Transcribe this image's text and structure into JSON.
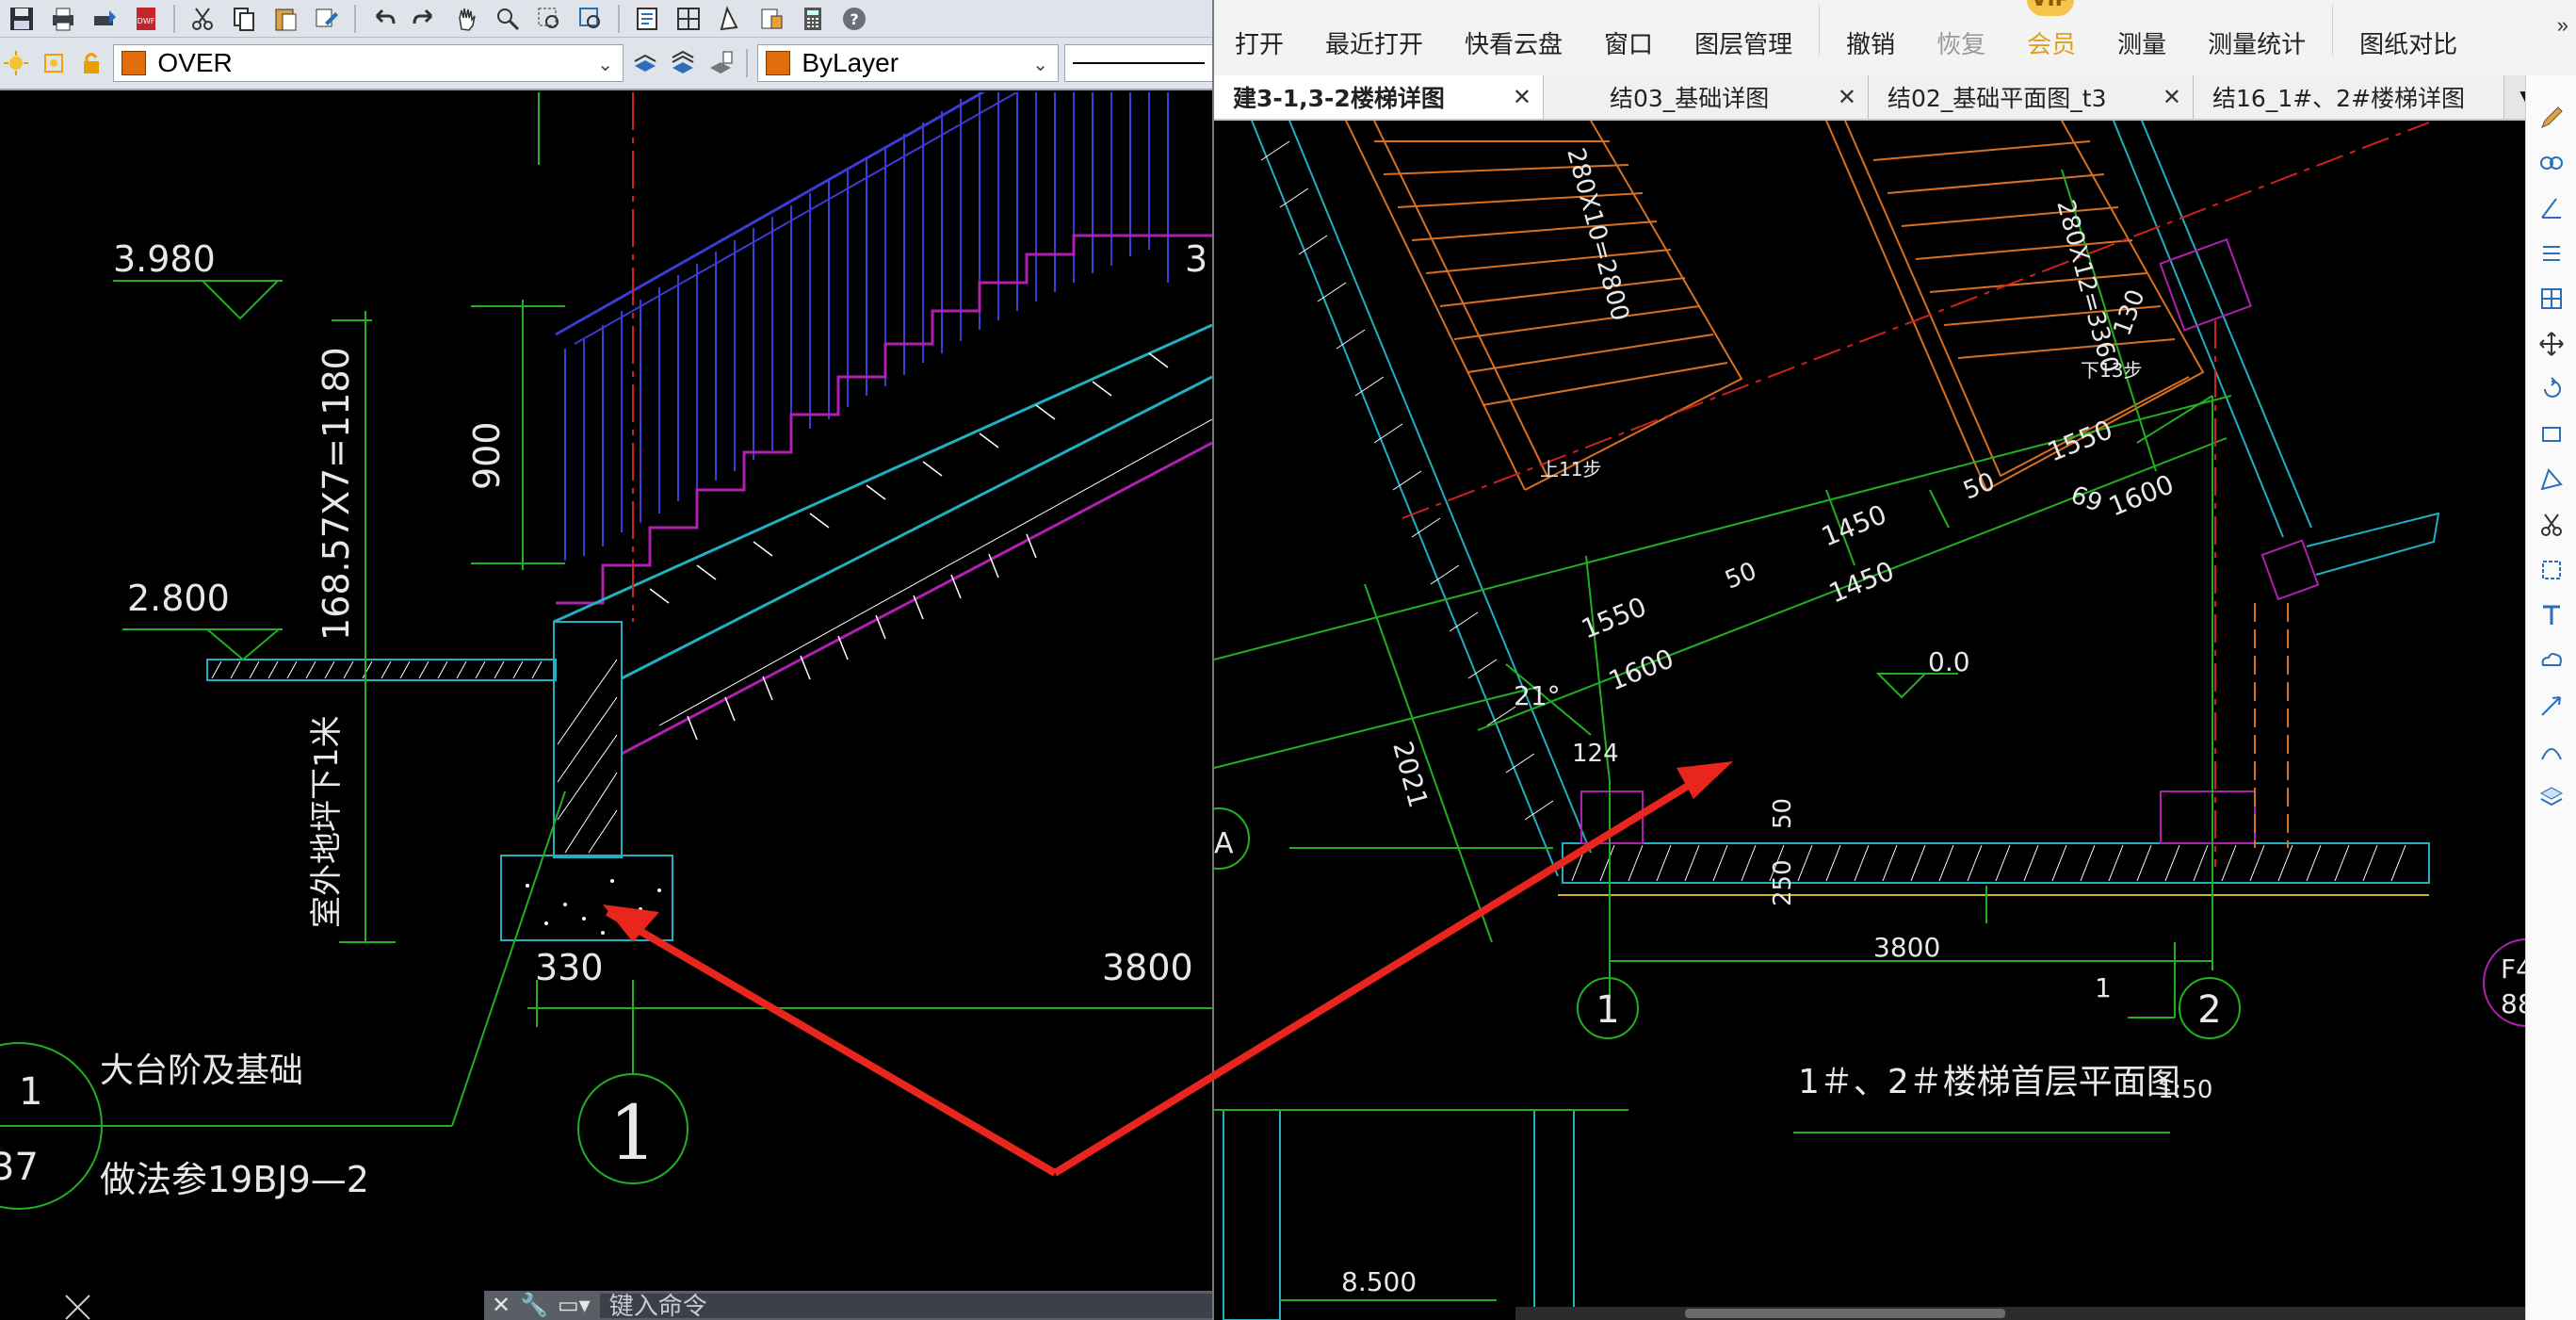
{
  "left_app": {
    "layer_current": "OVER",
    "linetype_current": "ByLayer",
    "colors": {
      "layer_swatch": "#e06c0c",
      "background": "#000000"
    },
    "toolbar_icons": [
      "save-icon",
      "print-icon",
      "plot-icon",
      "publish-icon",
      "dwf-icon",
      "cut-icon",
      "copy-icon",
      "paste-icon",
      "match-properties-icon",
      "undo-icon",
      "redo-icon",
      "pan-icon",
      "zoom-realtime-icon",
      "zoom-window-icon",
      "zoom-previous-icon",
      "properties-icon",
      "design-center-icon",
      "tool-palettes-icon",
      "markup-icon",
      "calculator-icon",
      "help-icon"
    ],
    "command_placeholder": "键入命令",
    "drawing": {
      "elev_top": "3.980",
      "elev_mid": "2.800",
      "dim_vertical": "168.57X7=1180",
      "dim_rail": "900",
      "dim_bottom_left": "330",
      "dim_bottom_right": "3800",
      "note_ground": "室外地坪下1米",
      "grid_axis": "1",
      "detail_ref_top": "1",
      "detail_ref_bottom": "37",
      "detail_title": "大台阶及基础",
      "detail_note": "做法参19BJ9—2",
      "partial_top_right": "3"
    }
  },
  "right_app": {
    "toolbar": {
      "open": "打开",
      "recent": "最近打开",
      "cloud": "快看云盘",
      "window": "窗口",
      "layers": "图层管理",
      "undo": "撤销",
      "redo": "恢复",
      "vip": "会员",
      "vip_badge": "VIP",
      "measure": "测量",
      "measure_stats": "测量统计",
      "compare": "图纸对比",
      "more": "»"
    },
    "tabs": [
      {
        "label": "建3-1,3-2楼梯详图",
        "active": true
      },
      {
        "label": "结03_基础详图",
        "active": false
      },
      {
        "label": "结02_基础平面图_t3",
        "active": false
      },
      {
        "label": "结16_1#、2#楼梯详图",
        "active": false
      }
    ],
    "tab_close": "✕",
    "tab_overflow": "▼",
    "drawing": {
      "title": "1＃、2＃楼梯首层平面图",
      "scale": "1:50",
      "dims": {
        "d3800": "3800",
        "d1550_a": "1550",
        "d1550_b": "1550",
        "d1450_a": "1450",
        "d1450_b": "1450",
        "d1600_a": "1600",
        "d1600_b": "1600",
        "d50_a": "50",
        "d50_b": "50",
        "d50_c": "50",
        "d250": "250",
        "d124": "124",
        "d2021": "2021",
        "d130": "130",
        "d69": "69",
        "stair_a": "280X10=2800",
        "stair_b": "280X12=3360"
      },
      "angle": "21°",
      "level": "0.0",
      "step_a": "上11步",
      "step_b": "下13步",
      "axis_1": "1",
      "axis_2": "2",
      "axis_a": "A",
      "mark_1": "1",
      "elev_bottom": "8.500",
      "partial_right_a": "F4",
      "partial_right_b": "88"
    }
  }
}
